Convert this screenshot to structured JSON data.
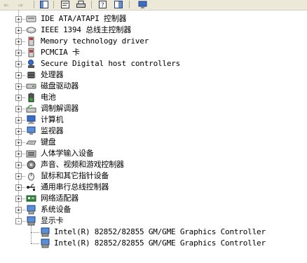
{
  "toolbar": {
    "back_icon": "back-arrow-icon",
    "forward_icon": "forward-arrow-icon",
    "buttons": [
      "show-hide-console-tree-icon",
      "properties-icon",
      "print-icon",
      "help-icon",
      "scan-hardware-icon",
      "device-icon"
    ]
  },
  "tree": {
    "items": [
      {
        "label": "IDE ATA/ATAPI 控制器",
        "icon": "ide-controller-icon",
        "expander": "+"
      },
      {
        "label": "IEEE 1394 总线主控制器",
        "icon": "ieee1394-icon",
        "expander": "+"
      },
      {
        "label": "Memory technology driver",
        "icon": "memory-card-icon",
        "expander": "+"
      },
      {
        "label": "PCMCIA 卡",
        "icon": "pcmcia-icon",
        "expander": "+"
      },
      {
        "label": "Secure Digital host controllers",
        "icon": "sd-host-icon",
        "expander": "+"
      },
      {
        "label": "处理器",
        "icon": "processor-icon",
        "expander": "+"
      },
      {
        "label": "磁盘驱动器",
        "icon": "disk-drive-icon",
        "expander": "+"
      },
      {
        "label": "电池",
        "icon": "battery-icon",
        "expander": "+"
      },
      {
        "label": "调制解调器",
        "icon": "modem-icon",
        "expander": "+"
      },
      {
        "label": "计算机",
        "icon": "computer-icon",
        "expander": "+"
      },
      {
        "label": "监视器",
        "icon": "monitor-icon",
        "expander": "+"
      },
      {
        "label": "键盘",
        "icon": "keyboard-icon",
        "expander": "+"
      },
      {
        "label": "人体学输入设备",
        "icon": "hid-icon",
        "expander": "+"
      },
      {
        "label": "声音、视频和游戏控制器",
        "icon": "sound-icon",
        "expander": "+"
      },
      {
        "label": "鼠标和其它指针设备",
        "icon": "mouse-icon",
        "expander": "+"
      },
      {
        "label": "通用串行总线控制器",
        "icon": "usb-icon",
        "expander": "+"
      },
      {
        "label": "网络适配器",
        "icon": "network-adapter-icon",
        "expander": "+"
      },
      {
        "label": "系统设备",
        "icon": "system-device-icon",
        "expander": "+"
      },
      {
        "label": "显示卡",
        "icon": "display-adapter-icon",
        "expander": "-"
      }
    ],
    "children": [
      {
        "label": "Intel(R) 82852/82855 GM/GME Graphics Controller",
        "icon": "display-adapter-icon"
      },
      {
        "label": "Intel(R) 82852/82855 GM/GME Graphics Controller",
        "icon": "display-adapter-icon"
      }
    ]
  },
  "colors": {
    "toolbar_bg": "#ece9d8",
    "tree_line": "#808080",
    "text": "#000000"
  }
}
